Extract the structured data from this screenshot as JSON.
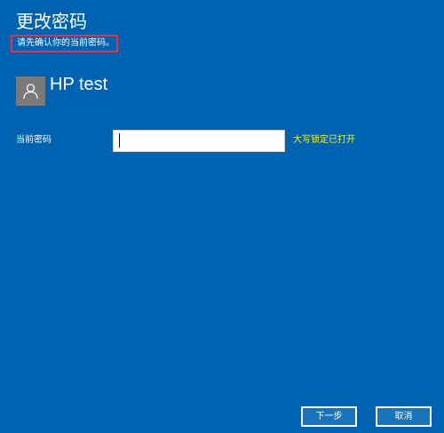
{
  "dialog": {
    "title": "更改密码",
    "subtitle": "请先确认你的当前密码。"
  },
  "user": {
    "name": "HP test",
    "avatar_icon": "user-silhouette-icon"
  },
  "form": {
    "password_label": "当前密码",
    "password_value": "",
    "caps_lock_warning": "大写锁定已打开"
  },
  "buttons": {
    "next": "下一步",
    "cancel": "取消"
  },
  "colors": {
    "background": "#0063b1",
    "highlight_border": "#e0354b",
    "warning_text": "#f3f33a"
  }
}
